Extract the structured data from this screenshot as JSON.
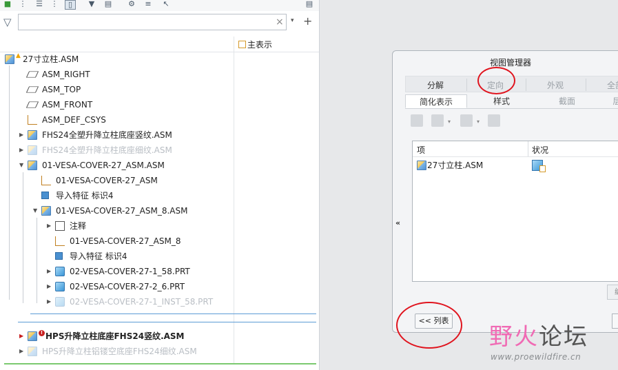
{
  "search": {
    "value": "",
    "clear": "×",
    "add": "+",
    "dropdown": "▾"
  },
  "column": {
    "header": "主表示"
  },
  "tree": [
    {
      "label": "27寸立柱.ASM",
      "icon": "assembly-icon",
      "state": "normal",
      "badge": "warning"
    },
    {
      "label": "ASM_RIGHT",
      "icon": "datum-plane-icon",
      "state": "normal"
    },
    {
      "label": "ASM_TOP",
      "icon": "datum-plane-icon",
      "state": "normal"
    },
    {
      "label": "ASM_FRONT",
      "icon": "datum-plane-icon",
      "state": "normal"
    },
    {
      "label": "ASM_DEF_CSYS",
      "icon": "coordinate-system-icon",
      "state": "normal"
    },
    {
      "label": "FHS24全塑升降立柱底座竖纹.ASM",
      "icon": "assembly-icon",
      "state": "normal"
    },
    {
      "label": "FHS24全塑升降立柱底座细纹.ASM",
      "icon": "assembly-icon",
      "state": "dim"
    },
    {
      "label": "01-VESA-COVER-27_ASM.ASM",
      "icon": "assembly-icon",
      "state": "normal"
    },
    {
      "label": "01-VESA-COVER-27_ASM",
      "icon": "coordinate-system-icon",
      "state": "normal"
    },
    {
      "label": "导入特征 标识4",
      "icon": "import-feature-icon",
      "state": "normal"
    },
    {
      "label": "01-VESA-COVER-27_ASM_8.ASM",
      "icon": "assembly-icon",
      "state": "normal"
    },
    {
      "label": "注释",
      "icon": "annotation-icon",
      "state": "normal"
    },
    {
      "label": "01-VESA-COVER-27_ASM_8",
      "icon": "coordinate-system-icon",
      "state": "normal"
    },
    {
      "label": "导入特征 标识4",
      "icon": "import-feature-icon",
      "state": "normal"
    },
    {
      "label": "02-VESA-COVER-27-1_58.PRT",
      "icon": "part-icon",
      "state": "normal"
    },
    {
      "label": "02-VESA-COVER-27-2_6.PRT",
      "icon": "part-icon",
      "state": "normal"
    },
    {
      "label": "02-VESA-COVER-27-1_INST_58.PRT",
      "icon": "part-icon",
      "state": "dim"
    },
    {
      "label": "HPS升降立柱底座FHS24竖纹.ASM",
      "icon": "assembly-icon",
      "state": "bold",
      "badge": "error"
    },
    {
      "label": "HPS升降立柱铝镂空底座FHS24细纹.ASM",
      "icon": "assembly-icon",
      "state": "dim"
    }
  ],
  "dialog": {
    "title": "视图管理器",
    "collapse": "«",
    "tabs_top": [
      "分解",
      "定向",
      "外观",
      "全剖"
    ],
    "tabs_bottom": [
      "简化表示",
      "样式",
      "截面",
      "层"
    ],
    "list": {
      "col_item": "项",
      "col_status": "状况",
      "rows": [
        {
          "item": "27寸立柱.ASM"
        }
      ]
    },
    "small_button": "编辑",
    "list_button": "<< 列表"
  },
  "watermark": {
    "main_a": "野火",
    "main_b": "论坛",
    "url": "www.proewildfire.cn"
  },
  "colors": {
    "annotation_circle": "#e0141e",
    "watermark_pink": "#f06ab4",
    "tree_blue_line": "#5b9bd5",
    "tree_green_line": "#7bc96f"
  }
}
